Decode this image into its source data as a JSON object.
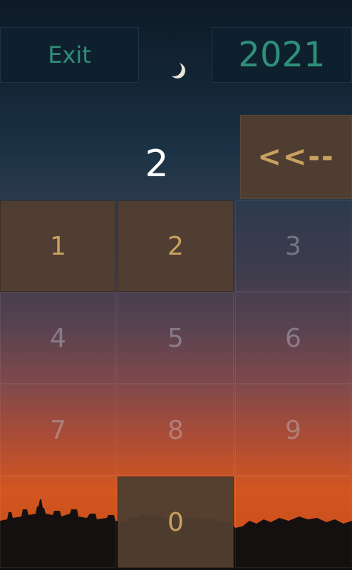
{
  "header": {
    "exit_label": "Exit",
    "year_value": "2021"
  },
  "entry": {
    "value": "2",
    "backspace_label": "<<--"
  },
  "keypad": {
    "k1": "1",
    "k2": "2",
    "k3": "3",
    "k4": "4",
    "k5": "5",
    "k6": "6",
    "k7": "7",
    "k8": "8",
    "k9": "9",
    "k0": "0"
  },
  "colors": {
    "accent_teal": "#2f8f79",
    "key_active_bg": "#4f3d31",
    "key_active_text": "#c9a160"
  },
  "icons": {
    "background": "crescent-moon-night-sky"
  }
}
